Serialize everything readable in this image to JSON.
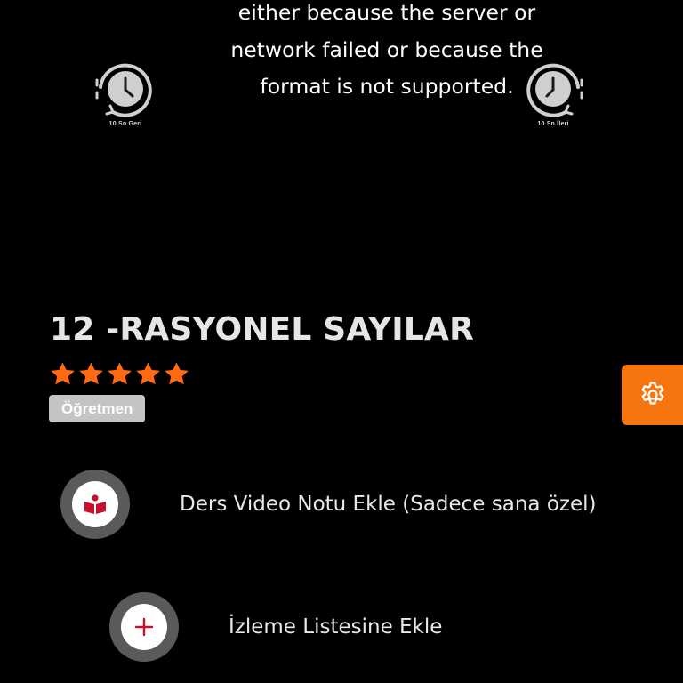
{
  "player": {
    "error_lines": [
      "either because the server or",
      "network failed or because the",
      "format is not supported."
    ],
    "seek_back_label": "10 Sn.Geri",
    "seek_forward_label": "10 Sn.İleri",
    "seek_back_icon": "rewind-10-clock-icon",
    "seek_forward_icon": "forward-10-clock-icon"
  },
  "lesson": {
    "title": "12 -RASYONEL SAYILAR",
    "rating": 5,
    "rating_max": 5,
    "role_badge": "Öğretmen"
  },
  "actions": {
    "add_note_label": "Ders Video Notu Ekle (Sadece sana özel)",
    "add_note_icon": "open-book-icon",
    "add_watchlist_label": "İzleme Listesine Ekle",
    "add_watchlist_icon": "plus-icon"
  },
  "settings": {
    "icon": "gear-icon"
  },
  "colors": {
    "background": "#000000",
    "accent": "#f7750f",
    "star": "#ff6a13",
    "icon_red": "#c8102e",
    "badge_bg": "#c4c4c4",
    "circle_ring": "#5a5a5a"
  }
}
